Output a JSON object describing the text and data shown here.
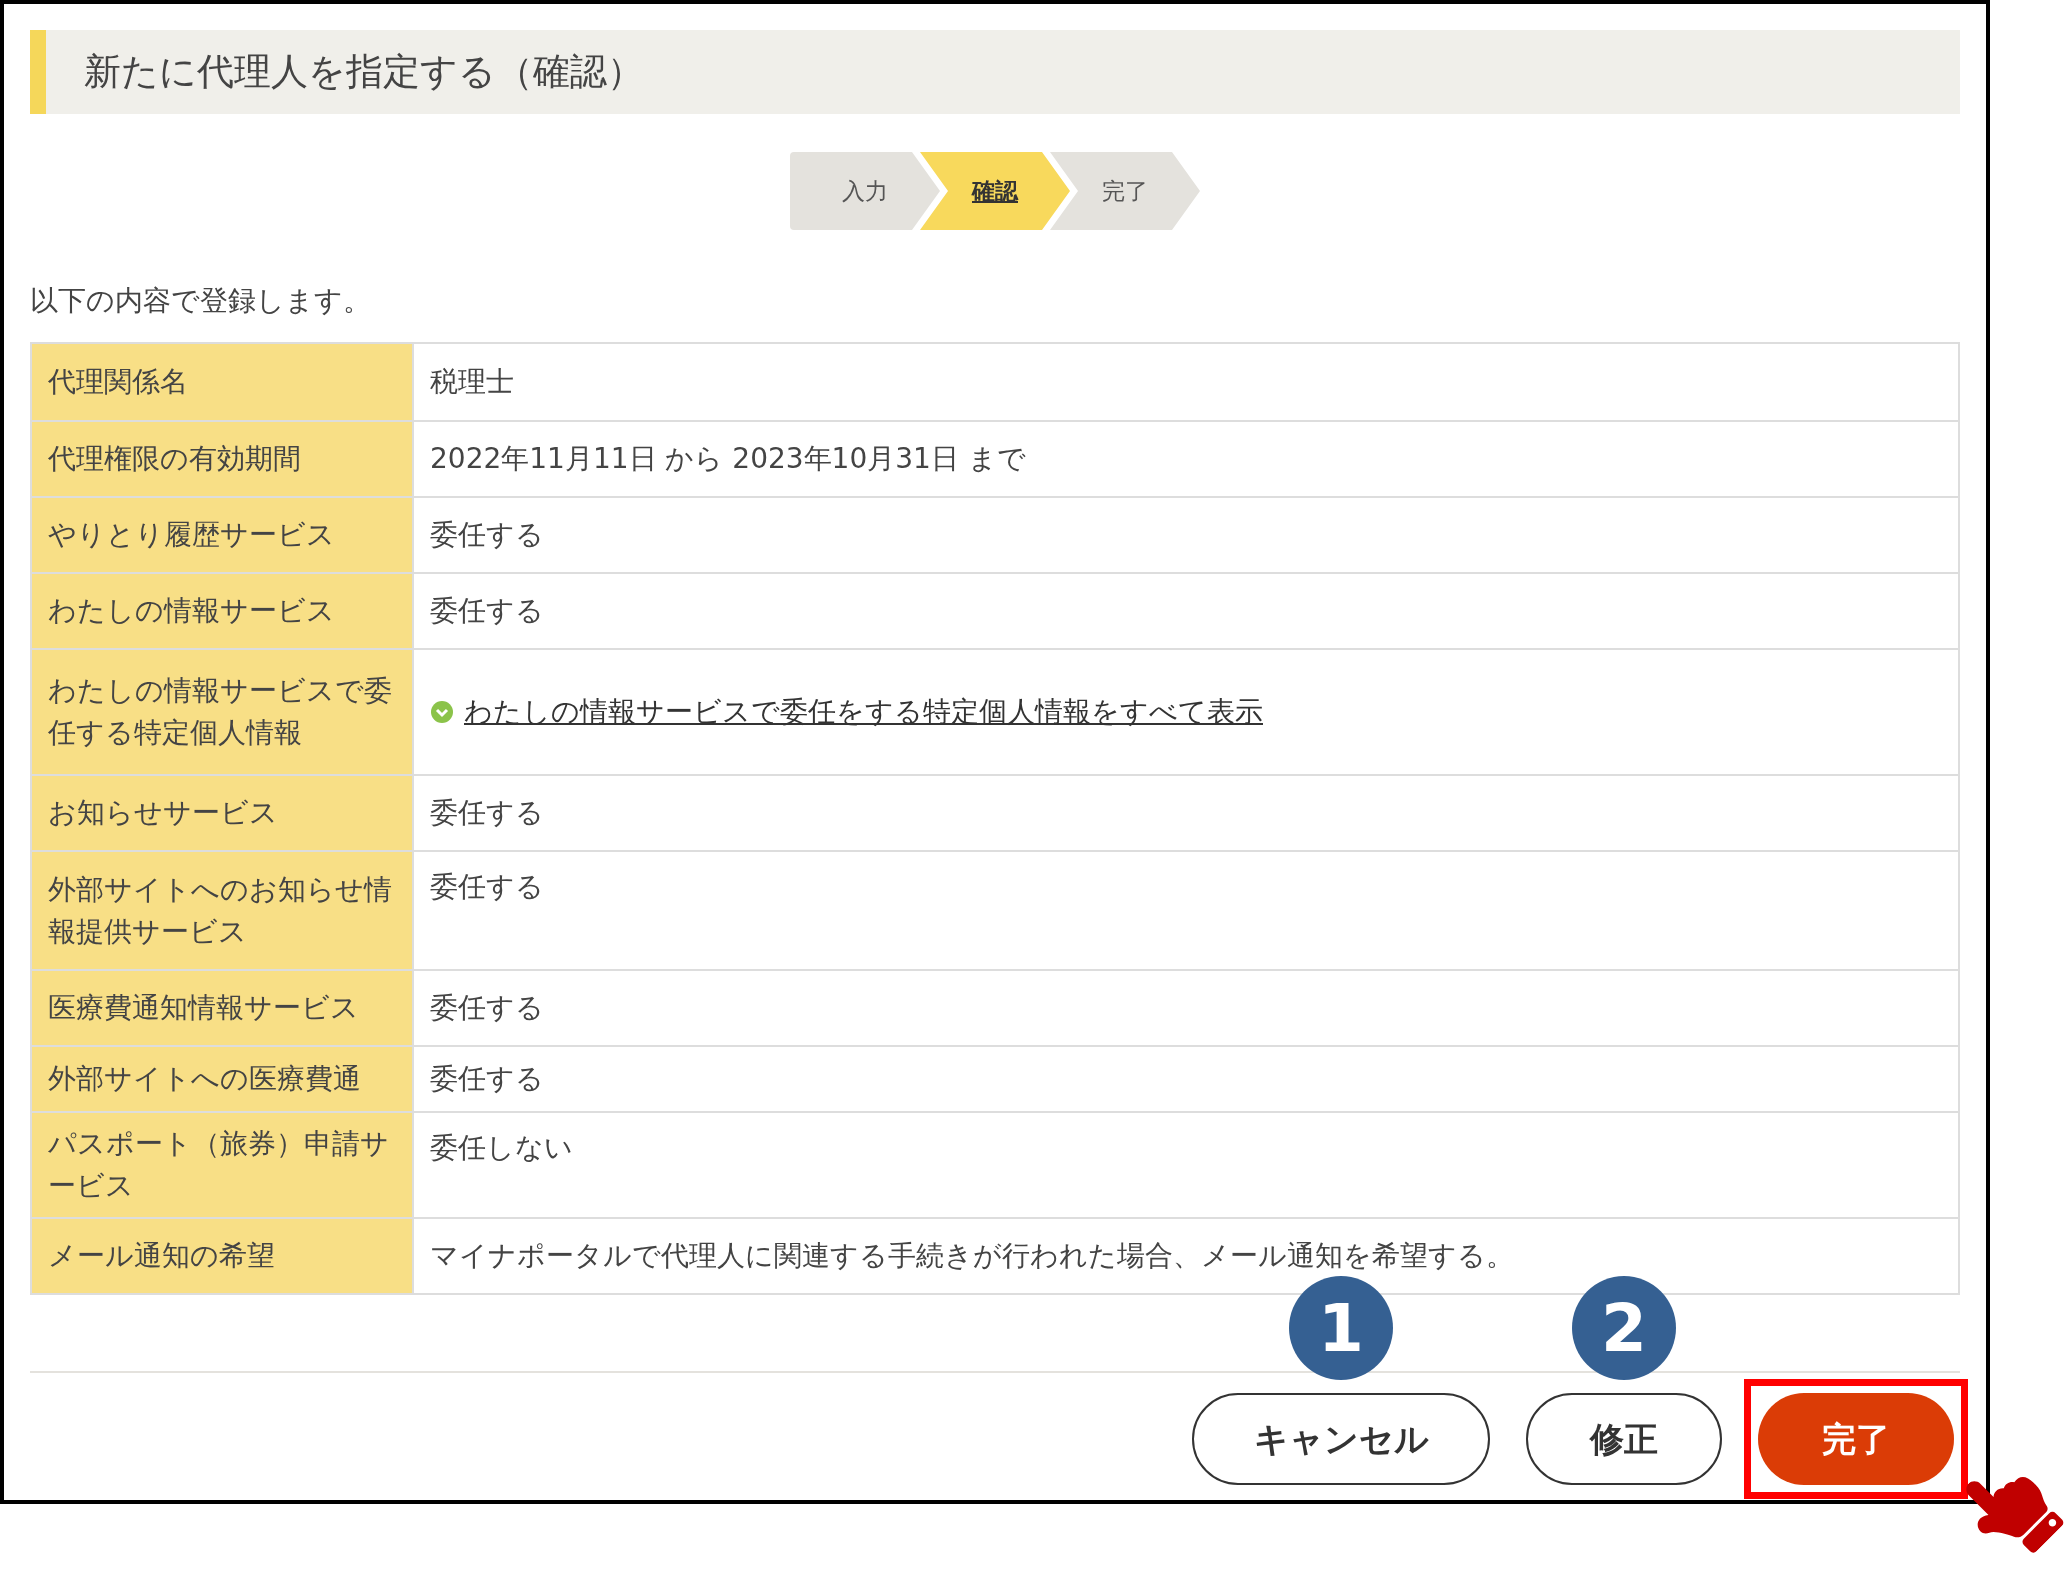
{
  "title": "新たに代理人を指定する（確認）",
  "steps": [
    {
      "label": "入力",
      "selected": false
    },
    {
      "label": "確認",
      "selected": true
    },
    {
      "label": "完了",
      "selected": false
    }
  ],
  "intro": "以下の内容で登録します。",
  "rows": [
    {
      "label": "代理関係名",
      "value": "税理士",
      "kind": "text"
    },
    {
      "label": "代理権限の有効期間",
      "value": "2022年11月11日 から 2023年10月31日 まで",
      "kind": "text"
    },
    {
      "label": "やりとり履歴サービス",
      "value": "委任する",
      "kind": "text"
    },
    {
      "label": "わたしの情報サービス",
      "value": "委任する",
      "kind": "text"
    },
    {
      "label": "わたしの情報サービスで委任する特定個人情報",
      "value": "わたしの情報サービスで委任をする特定個人情報をすべて表示",
      "kind": "link"
    },
    {
      "label": "お知らせサービス",
      "value": "委任する",
      "kind": "text"
    },
    {
      "label": "外部サイトへのお知らせ情報提供サービス",
      "value": "委任する",
      "kind": "text"
    },
    {
      "label": "医療費通知情報サービス",
      "value": "委任する",
      "kind": "text"
    },
    {
      "label": "外部サイトへの医療費通",
      "value": "委任する",
      "kind": "text"
    },
    {
      "label": "パスポート（旅券）申請サービス",
      "value": "委任しない",
      "kind": "text"
    },
    {
      "label": "メール通知の希望",
      "value": "マイナポータルで代理人に関連する手続きが行われた場合、メール通知を希望する。",
      "kind": "text"
    }
  ],
  "buttons": [
    {
      "label": "キャンセル",
      "kind": "outline",
      "highlighted": false,
      "callout": "1"
    },
    {
      "label": "修正",
      "kind": "outline",
      "highlighted": false,
      "callout": "2"
    },
    {
      "label": "完了",
      "kind": "primary",
      "highlighted": true
    }
  ]
}
